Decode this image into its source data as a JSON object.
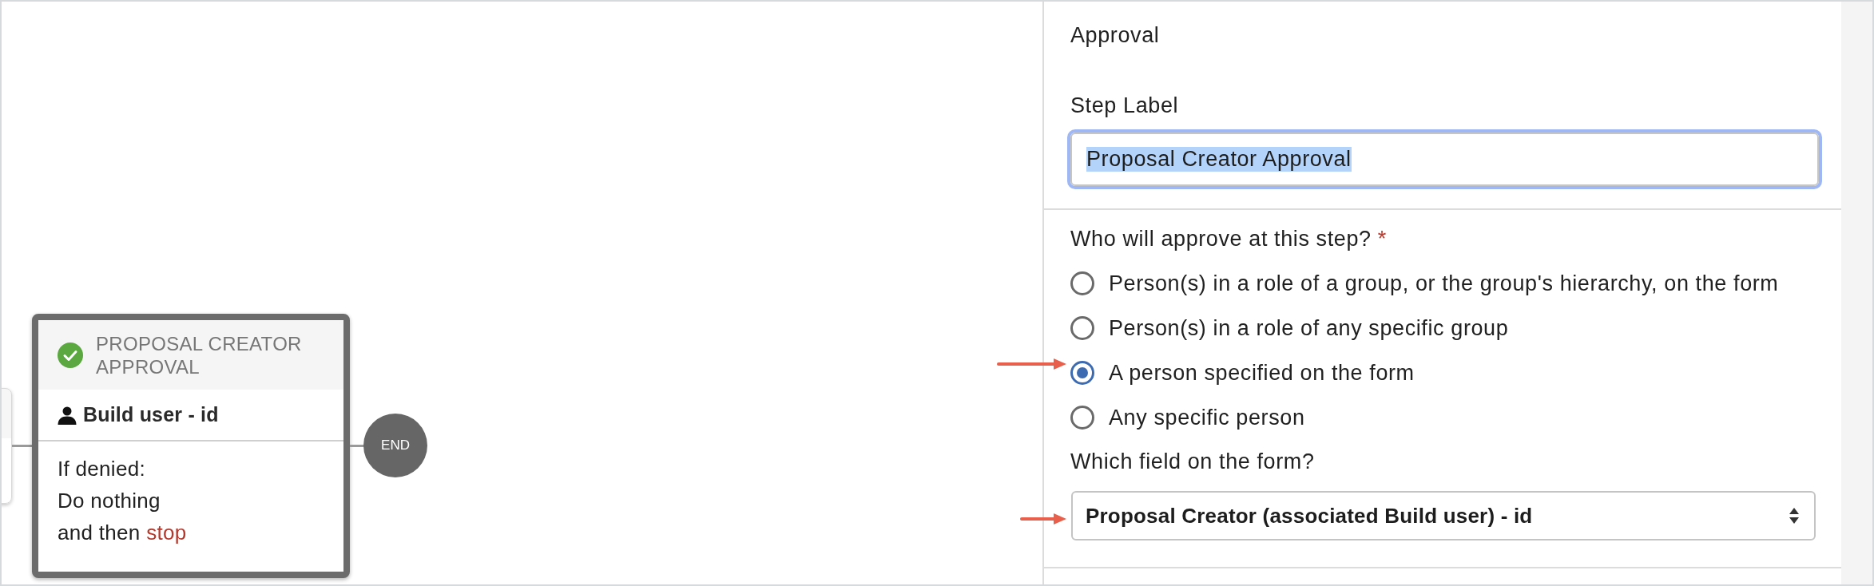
{
  "diagram": {
    "step": {
      "complete": true,
      "title": "PROPOSAL CREATOR APPROVAL",
      "approver": "Build user - id",
      "denied_label": "If denied:",
      "denied_action": "Do nothing",
      "then_prefix": "and then",
      "then_action": "stop"
    },
    "end_node": {
      "label": "END"
    }
  },
  "panel": {
    "title": "Approval",
    "step_label": {
      "label": "Step Label",
      "value": "Proposal Creator Approval",
      "focused": true,
      "text_highlighted": true
    },
    "approver_question": {
      "label": "Who will approve at this step?",
      "required_mark": "*",
      "options": [
        {
          "label": "Person(s) in a role of a group, or the group's hierarchy, on the form",
          "selected": false,
          "arrow_pointer": false
        },
        {
          "label": "Person(s) in a role of any specific group",
          "selected": false,
          "arrow_pointer": false
        },
        {
          "label": "A person specified on the form",
          "selected": true,
          "arrow_pointer": true
        },
        {
          "label": "Any specific person",
          "selected": false,
          "arrow_pointer": false
        }
      ]
    },
    "field_question": {
      "label": "Which field on the form?",
      "value": "Proposal Creator (associated Build user) - id",
      "arrow_pointer": true
    }
  }
}
